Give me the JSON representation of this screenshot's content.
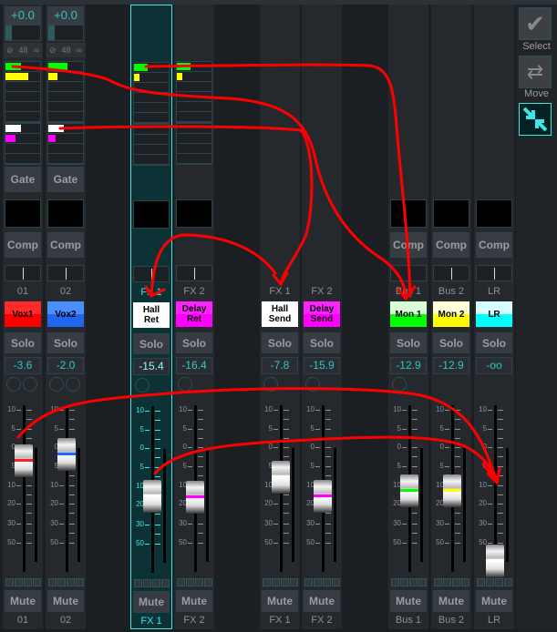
{
  "strips": [
    {
      "id": "01",
      "label": "01",
      "name": "Vox1",
      "name_top": "#ff2a2a",
      "name_bot": "#ff0000",
      "solo": "Solo",
      "value": "-3.6",
      "db": -3.6,
      "mute": "Mute",
      "cap_color": "#ff2020",
      "gain": "+0.0",
      "phantom": "48",
      "meters": [
        {
          "c": "#00ff00",
          "f": 0.45
        },
        {
          "c": "#ffff00",
          "f": 0.65
        }
      ],
      "meters2": [
        {
          "c": "#ffffff",
          "f": 0.45
        },
        {
          "c": "#ff00ff",
          "f": 0.3
        }
      ],
      "gate": "Gate",
      "comp": "Comp",
      "knobs": 2
    },
    {
      "id": "02",
      "label": "02",
      "name": "Vox2",
      "name_top": "#4b8fff",
      "name_bot": "#2266ee",
      "solo": "Solo",
      "value": "-2.0",
      "db": -2.0,
      "mute": "Mute",
      "cap_color": "#2266ff",
      "gain": "+0.0",
      "phantom": "48",
      "meters": [
        {
          "c": "#00ff00",
          "f": 0.55
        },
        {
          "c": "#ffff00",
          "f": 0.25
        }
      ],
      "meters2": [
        {
          "c": "#ffffff",
          "f": 0.45
        },
        {
          "c": "#ff00ff",
          "f": 0.2
        }
      ],
      "gate": "Gate",
      "comp": "Comp",
      "knobs": 2
    },
    {
      "id": "fx1ret",
      "label": "FX 1",
      "name": "Hall\nRet",
      "name_top": "#ffffff",
      "name_bot": "#ffffff",
      "solo": "Solo",
      "value": "-15.4",
      "db": -15.4,
      "mute": "Mute",
      "cap_color": "#ffffff",
      "selected": true,
      "meters": [
        {
          "c": "#00ff00",
          "f": 0.4
        },
        {
          "c": "#ffff00",
          "f": 0.17
        }
      ],
      "knobs": 1
    },
    {
      "id": "fx2ret",
      "label": "FX 2",
      "name": "Delay\nRet",
      "name_top": "#ff22ff",
      "name_bot": "#ff00ff",
      "solo": "Solo",
      "value": "-16.4",
      "db": -16.4,
      "mute": "Mute",
      "cap_color": "#ff00ff",
      "meters": [
        {
          "c": "#00ff00",
          "f": 0.4
        },
        {
          "c": "#ffff00",
          "f": 0.17
        }
      ],
      "knobs": 1
    },
    {
      "id": "fx1send",
      "label": "FX 1",
      "name": "Hall\nSend",
      "name_top": "#ffffff",
      "name_bot": "#ffffff",
      "solo": "Solo",
      "value": "-7.8",
      "db": -7.8,
      "mute": "Mute",
      "cap_color": "#ffffff",
      "knobs": 1
    },
    {
      "id": "fx2send",
      "label": "FX 2",
      "name": "Delay\nSend",
      "name_top": "#ff22ff",
      "name_bot": "#ff00ff",
      "solo": "Solo",
      "value": "-15.9",
      "db": -15.9,
      "mute": "Mute",
      "cap_color": "#ff00ff",
      "knobs": 1
    },
    {
      "id": "bus1",
      "label": "Bus 1",
      "name": "Mon 1",
      "name_top": "#d8ffd8",
      "name_bot": "#00ff00",
      "solo": "Solo",
      "value": "-12.9",
      "db": -12.9,
      "mute": "Mute",
      "cap_color": "#00ff00",
      "comp": "Comp",
      "knobs": 1
    },
    {
      "id": "bus2",
      "label": "Bus 2",
      "name": "Mon 2",
      "name_top": "#ffffd8",
      "name_bot": "#ffff00",
      "solo": "Solo",
      "value": "-12.9",
      "db": -12.9,
      "mute": "Mute",
      "cap_color": "#ffff00",
      "comp": "Comp",
      "knobs": 0
    },
    {
      "id": "lr",
      "label": "LR",
      "name": "LR",
      "name_top": "#d8ffff",
      "name_bot": "#00ffff",
      "solo": "Solo",
      "value": "-oo",
      "db": -100,
      "mute": "Mute",
      "cap_color": "#ffffff",
      "comp": "Comp",
      "knobs": 0
    }
  ],
  "scale": [
    "10",
    "5",
    "0",
    "5",
    "10",
    "20",
    "30",
    "50"
  ],
  "tools": {
    "select": "Select",
    "move": "Move"
  }
}
